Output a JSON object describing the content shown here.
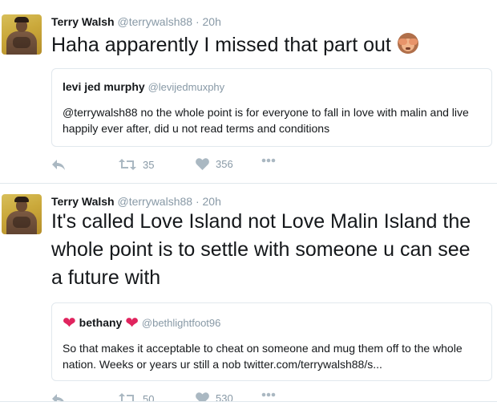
{
  "tweets": [
    {
      "author_name": "Terry Walsh",
      "author_handle": "@terrywalsh88",
      "separator": " · ",
      "time": "20h",
      "text": "Haha apparently I missed that part out",
      "emoji": "see-no-evil-monkey",
      "quote": {
        "author_name": "levi jed murphy",
        "author_handle": "@levijedmuxphy",
        "text": "@terrywalsh88 no the whole point is for everyone to fall in love with malin and live happily ever after, did u not read terms and conditions"
      },
      "retweets": "35",
      "likes": "356"
    },
    {
      "author_name": "Terry Walsh",
      "author_handle": "@terrywalsh88",
      "separator": " · ",
      "time": "20h",
      "text": "It's called Love Island not Love Malin Island the whole point is to settle with someone u can see a future with",
      "quote": {
        "author_name": "bethany",
        "author_handle": "@bethlightfoot96",
        "text": "So that makes it acceptable to cheat on someone and mug them off to the whole nation. Weeks or years ur still a nob twitter.com/terrywalsh88/s..."
      },
      "retweets": "50",
      "likes": "530"
    }
  ],
  "icons": {
    "reply": "reply-icon",
    "retweet": "retweet-icon",
    "like": "heart-icon",
    "more": "more-icon"
  },
  "colors": {
    "icon_gray": "#aab8c2",
    "heart_red": "#e0245e",
    "divider": "#e1e8ed"
  }
}
